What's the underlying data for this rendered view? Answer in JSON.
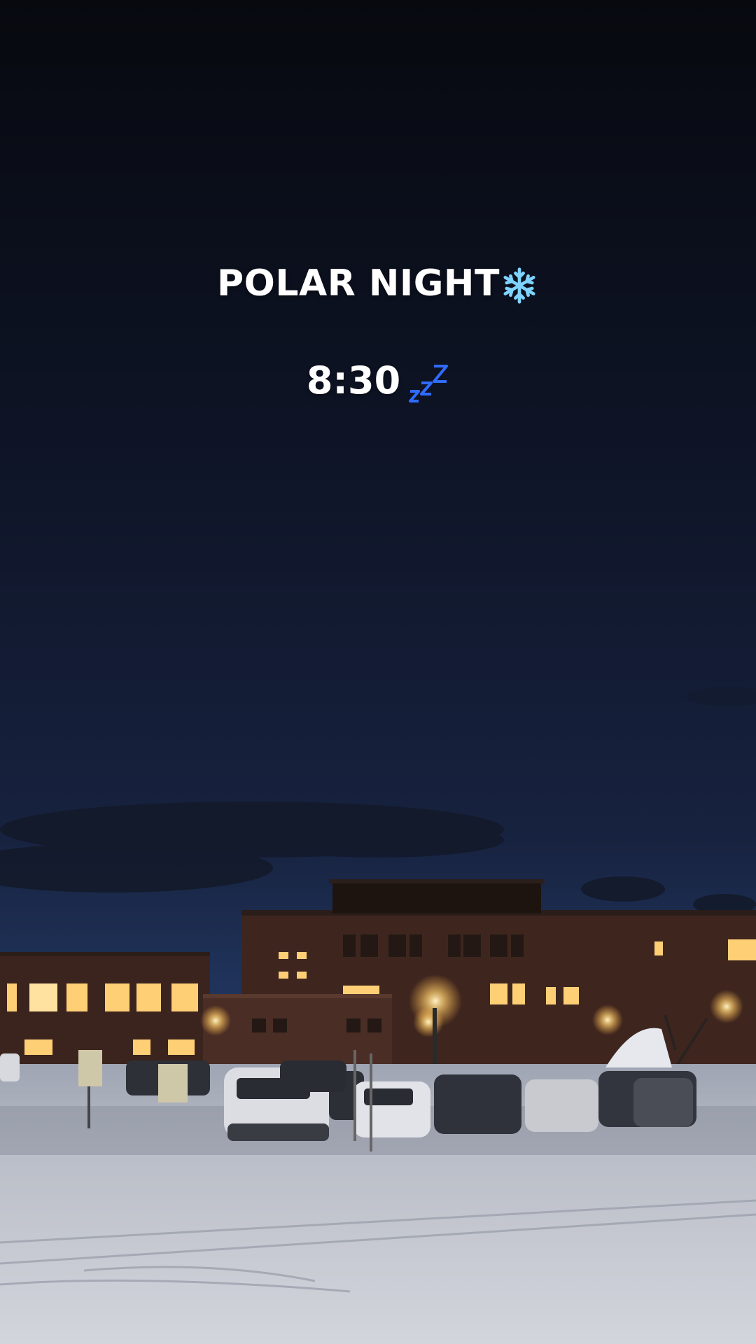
{
  "story": {
    "title": "POLAR NIGHT",
    "title_icon": "snowflake-icon",
    "time": "8:30",
    "time_icon": "zzz-sleep-icon"
  },
  "colors": {
    "sky_top": "#0a0d1a",
    "sky_mid": "#121a33",
    "sky_horizon": "#2a3f6e",
    "building": "#4a2d23",
    "window_light": "#ffd27a",
    "snow": "#c9cdd6",
    "snowflake": "#7fd3ff",
    "zzz": "#2f6bff",
    "text": "#ffffff"
  }
}
